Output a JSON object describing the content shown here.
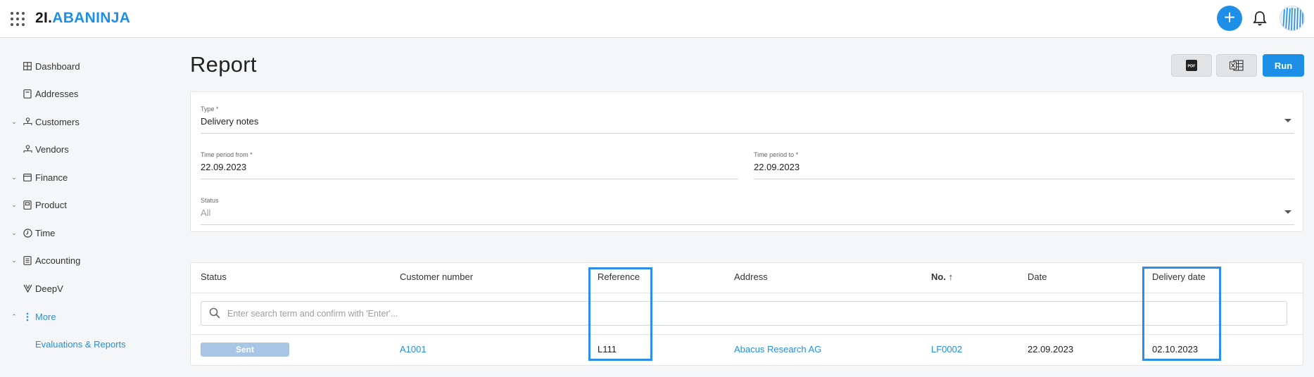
{
  "app": {
    "logo_prefix": "2I.",
    "logo_name": "ABANINJA",
    "add_label": "+"
  },
  "sidebar": {
    "items": [
      {
        "label": "Dashboard",
        "icon": "dashboard-icon",
        "chevron": ""
      },
      {
        "label": "Addresses",
        "icon": "address-book-icon",
        "chevron": ""
      },
      {
        "label": "Customers",
        "icon": "customers-icon",
        "chevron": "⌄"
      },
      {
        "label": "Vendors",
        "icon": "vendors-icon",
        "chevron": ""
      },
      {
        "label": "Finance",
        "icon": "finance-icon",
        "chevron": "⌄"
      },
      {
        "label": "Product",
        "icon": "product-icon",
        "chevron": "⌄"
      },
      {
        "label": "Time",
        "icon": "clock-icon",
        "chevron": "⌄"
      },
      {
        "label": "Accounting",
        "icon": "accounting-icon",
        "chevron": "⌄"
      },
      {
        "label": "DeepV",
        "icon": "deepv-icon",
        "chevron": ""
      },
      {
        "label": "More",
        "icon": "more-vertical-icon",
        "chevron": "⌃"
      }
    ],
    "sub_item": "Evaluations & Reports"
  },
  "page": {
    "title": "Report",
    "run_label": "Run",
    "pdf_icon_label": "PDF"
  },
  "form": {
    "type": {
      "label": "Type *",
      "value": "Delivery notes"
    },
    "from": {
      "label": "Time period from *",
      "value": "22.09.2023"
    },
    "to": {
      "label": "Time period to *",
      "value": "22.09.2023"
    },
    "status": {
      "label": "Status",
      "value": "All"
    }
  },
  "table": {
    "columns": [
      "Status",
      "Customer number",
      "Reference",
      "Address",
      "No.",
      "Date",
      "Delivery date"
    ],
    "sort_indicator": "↑",
    "search_placeholder": "Enter search term and confirm with 'Enter'...",
    "rows": [
      {
        "status": "Sent",
        "customer_number": "A1001",
        "reference": "L111",
        "address": "Abacus Research AG",
        "no": "LF0002",
        "date": "22.09.2023",
        "delivery_date": "02.10.2023"
      }
    ]
  },
  "colors": {
    "accent": "#1e8fe6",
    "badge": "#a7c6e6",
    "highlight": "#2b8ee8"
  }
}
